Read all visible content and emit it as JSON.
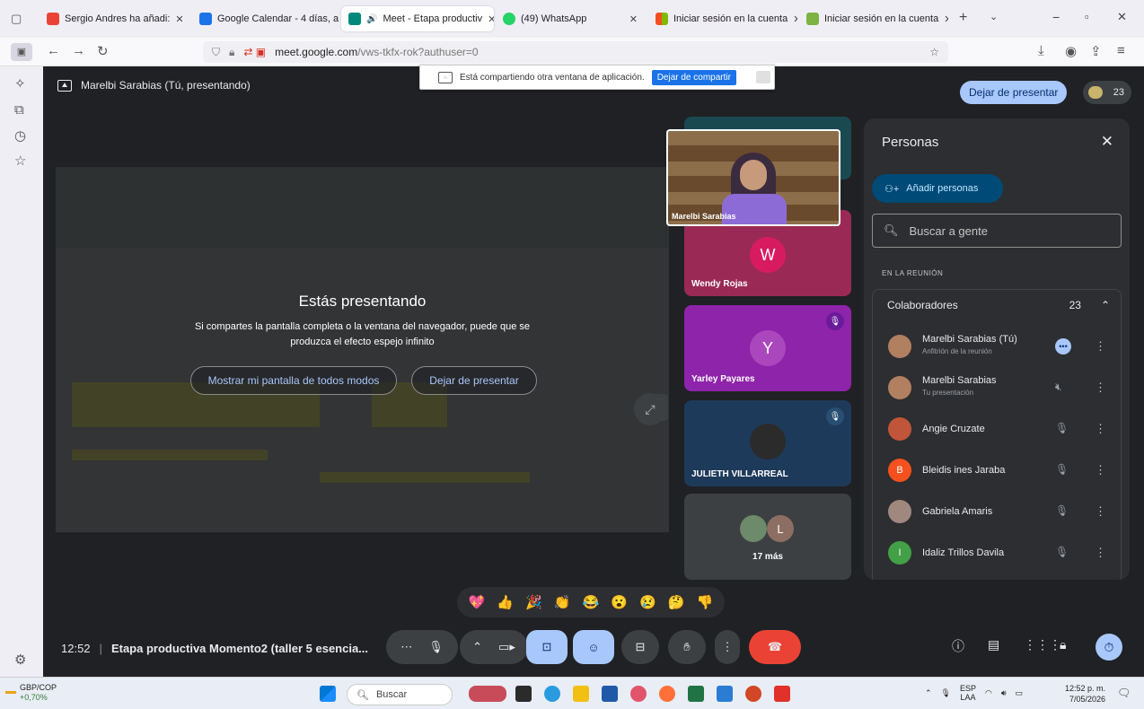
{
  "browser": {
    "tabs": [
      {
        "label": "Sergio Andres ha añadi:",
        "icon": "gmail-icon",
        "color": "#ea4335"
      },
      {
        "label": "Google Calendar - 4 días, a",
        "icon": "calendar-icon",
        "color": "#1a73e8"
      },
      {
        "label": "Meet - Etapa productiv",
        "icon": "meet-icon",
        "color": "#00897b"
      },
      {
        "label": "(49) WhatsApp",
        "icon": "whatsapp-icon",
        "color": "#25d366"
      },
      {
        "label": "Iniciar sesión en la cuenta",
        "icon": "microsoft-icon",
        "color": "#f25022"
      },
      {
        "label": "Iniciar sesión en la cuenta",
        "icon": "leaf-icon",
        "color": "#7cb342"
      }
    ],
    "url_host": "meet.google.com",
    "url_path": "/vws-tkfx-rok?authuser=0"
  },
  "share_banner": {
    "message": "Está compartiendo otra ventana de aplicación.",
    "stop_label": "Dejar de compartir"
  },
  "meet": {
    "presenter_label": "Marelbi Sarabias (Tú, presentando)",
    "stop_presenting_top": "Dejar de presentar",
    "participant_count": "23",
    "stage": {
      "title": "Estás presentando",
      "message": "Si compartes la pantalla completa o la ventana del navegador, puede que se produzca el efecto espejo infinito",
      "show_anyway": "Mostrar mi pantalla de todos modos",
      "stop": "Dejar de presentar"
    },
    "self_view_name": "Marelbi Sarabias",
    "tiles": [
      {
        "name": "Wendy Rojas",
        "initial": "W",
        "bg": "#9a2a55",
        "avatar": "#d81b60"
      },
      {
        "name": "Yarley Payares",
        "initial": "Y",
        "bg": "#8e24aa",
        "avatar": "#ab47bc"
      },
      {
        "name": "JULIETH VILLARREAL",
        "initial": "",
        "bg": "#1e3a5a",
        "avatar": "#2b2b2b"
      },
      {
        "name": "17 más",
        "initial": "L",
        "bg": "#3c4043",
        "avatar": "#8d6e63"
      }
    ],
    "reactions": [
      "💖",
      "👍",
      "🎉",
      "👏",
      "😂",
      "😮",
      "😢",
      "🤔",
      "👎"
    ],
    "meeting_time": "12:52",
    "meeting_title": "Etapa productiva Momento2 (taller 5 esencia..."
  },
  "people_panel": {
    "title": "Personas",
    "add_label": "Añadir personas",
    "search_placeholder": "Buscar a gente",
    "section_label": "EN LA REUNIÓN",
    "group_label": "Colaboradores",
    "group_count": "23",
    "people": [
      {
        "name": "Marelbi Sarabias (Tú)",
        "sub": "Anfitrión de la reunión",
        "color": "#b08060",
        "initial": ""
      },
      {
        "name": "Marelbi Sarabias",
        "sub": "Tu presentación",
        "color": "#b08060",
        "initial": ""
      },
      {
        "name": "Angie Cruzate",
        "sub": "",
        "color": "#c0553a",
        "initial": ""
      },
      {
        "name": "Bleidis ines Jaraba",
        "sub": "",
        "color": "#f4511e",
        "initial": "B"
      },
      {
        "name": "Gabriela Amaris",
        "sub": "",
        "color": "#a1887f",
        "initial": ""
      },
      {
        "name": "Idaliz Trillos Davila",
        "sub": "",
        "color": "#43a047",
        "initial": "I"
      }
    ]
  },
  "taskbar": {
    "ticker_name": "GBP/COP",
    "ticker_change": "+0,70%",
    "search_label": "Buscar",
    "lang_line1": "ESP",
    "lang_line2": "LAA",
    "time": "12:52 p. m.",
    "date": "7/05/2026"
  }
}
